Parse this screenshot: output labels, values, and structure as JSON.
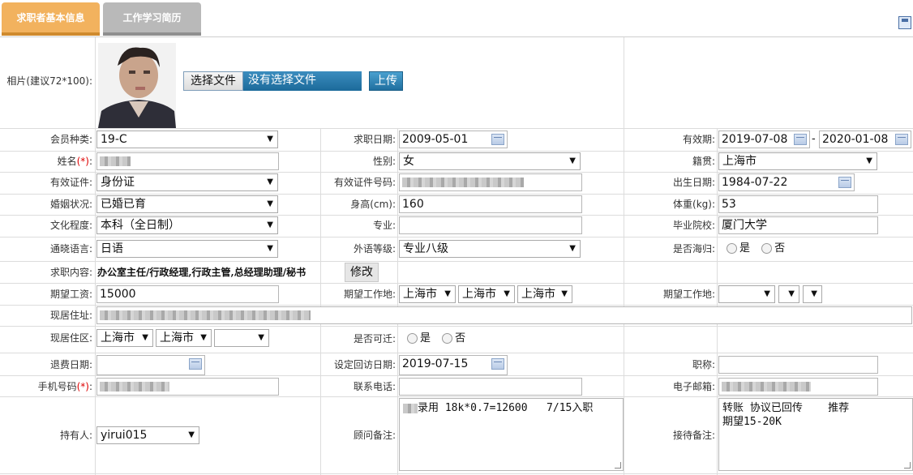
{
  "tabs": [
    "求职者基本信息",
    "工作学习简历"
  ],
  "labels": {
    "photo": "相片(建议72*100):",
    "member_type": "会员种类:",
    "job_date": "求职日期:",
    "valid_period": "有效期:",
    "name": "姓名",
    "gender": "性别:",
    "native_place": "籍贯:",
    "id_type": "有效证件:",
    "id_number": "有效证件号码:",
    "birth_date": "出生日期:",
    "marital": "婚姻状况:",
    "height": "身高(cm):",
    "weight": "体重(kg):",
    "education": "文化程度:",
    "major": "专业:",
    "school": "毕业院校:",
    "language": "通晓语言:",
    "language_level": "外语等级:",
    "returnee": "是否海归:",
    "job_content": "求职内容:",
    "salary": "期望工资:",
    "work_location": "期望工作地:",
    "work_location2": "期望工作地:",
    "current_address": "现居住址:",
    "current_area": "现居住区:",
    "relocate": "是否可迁:",
    "refund_date": "退费日期:",
    "visit_date": "设定回访日期:",
    "title": "职称:",
    "mobile": "手机号码",
    "phone": "联系电话:",
    "email": "电子邮箱:",
    "holder": "持有人:",
    "consultant_note": "顾问备注:",
    "reception_note": "接待备注:",
    "required_mark": "(*)",
    "colon": ":"
  },
  "upload": {
    "choose_button": "选择文件",
    "no_file": "没有选择文件",
    "upload_button": "上传"
  },
  "values": {
    "member_type": "19-C",
    "job_date": "2009-05-01",
    "valid_from": "2019-07-08",
    "valid_sep": "-",
    "valid_to": "2020-01-08",
    "gender": "女",
    "native_place": "上海市",
    "id_type": "身份证",
    "birth_date": "1984-07-22",
    "marital": "已婚已育",
    "height": "160",
    "weight": "53",
    "education": "本科（全日制）",
    "major": "",
    "school": "厦门大学",
    "language": "日语",
    "language_level": "专业八级",
    "yes": "是",
    "no": "否",
    "job_content": "办公室主任/行政经理,行政主管,总经理助理/秘书",
    "modify_button": "修改",
    "salary": "15000",
    "work_loc_1": "上海市",
    "work_loc_2": "上海市",
    "work_loc_3": "上海市",
    "area_1": "上海市",
    "area_2": "上海市",
    "area_3": "",
    "visit_date": "2019-07-15",
    "holder": "yirui015",
    "consultant_note": "录用 18k*0.7=12600   7/15入职",
    "reception_note": "转账 协议已回传    推荐\n期望15-20K"
  }
}
